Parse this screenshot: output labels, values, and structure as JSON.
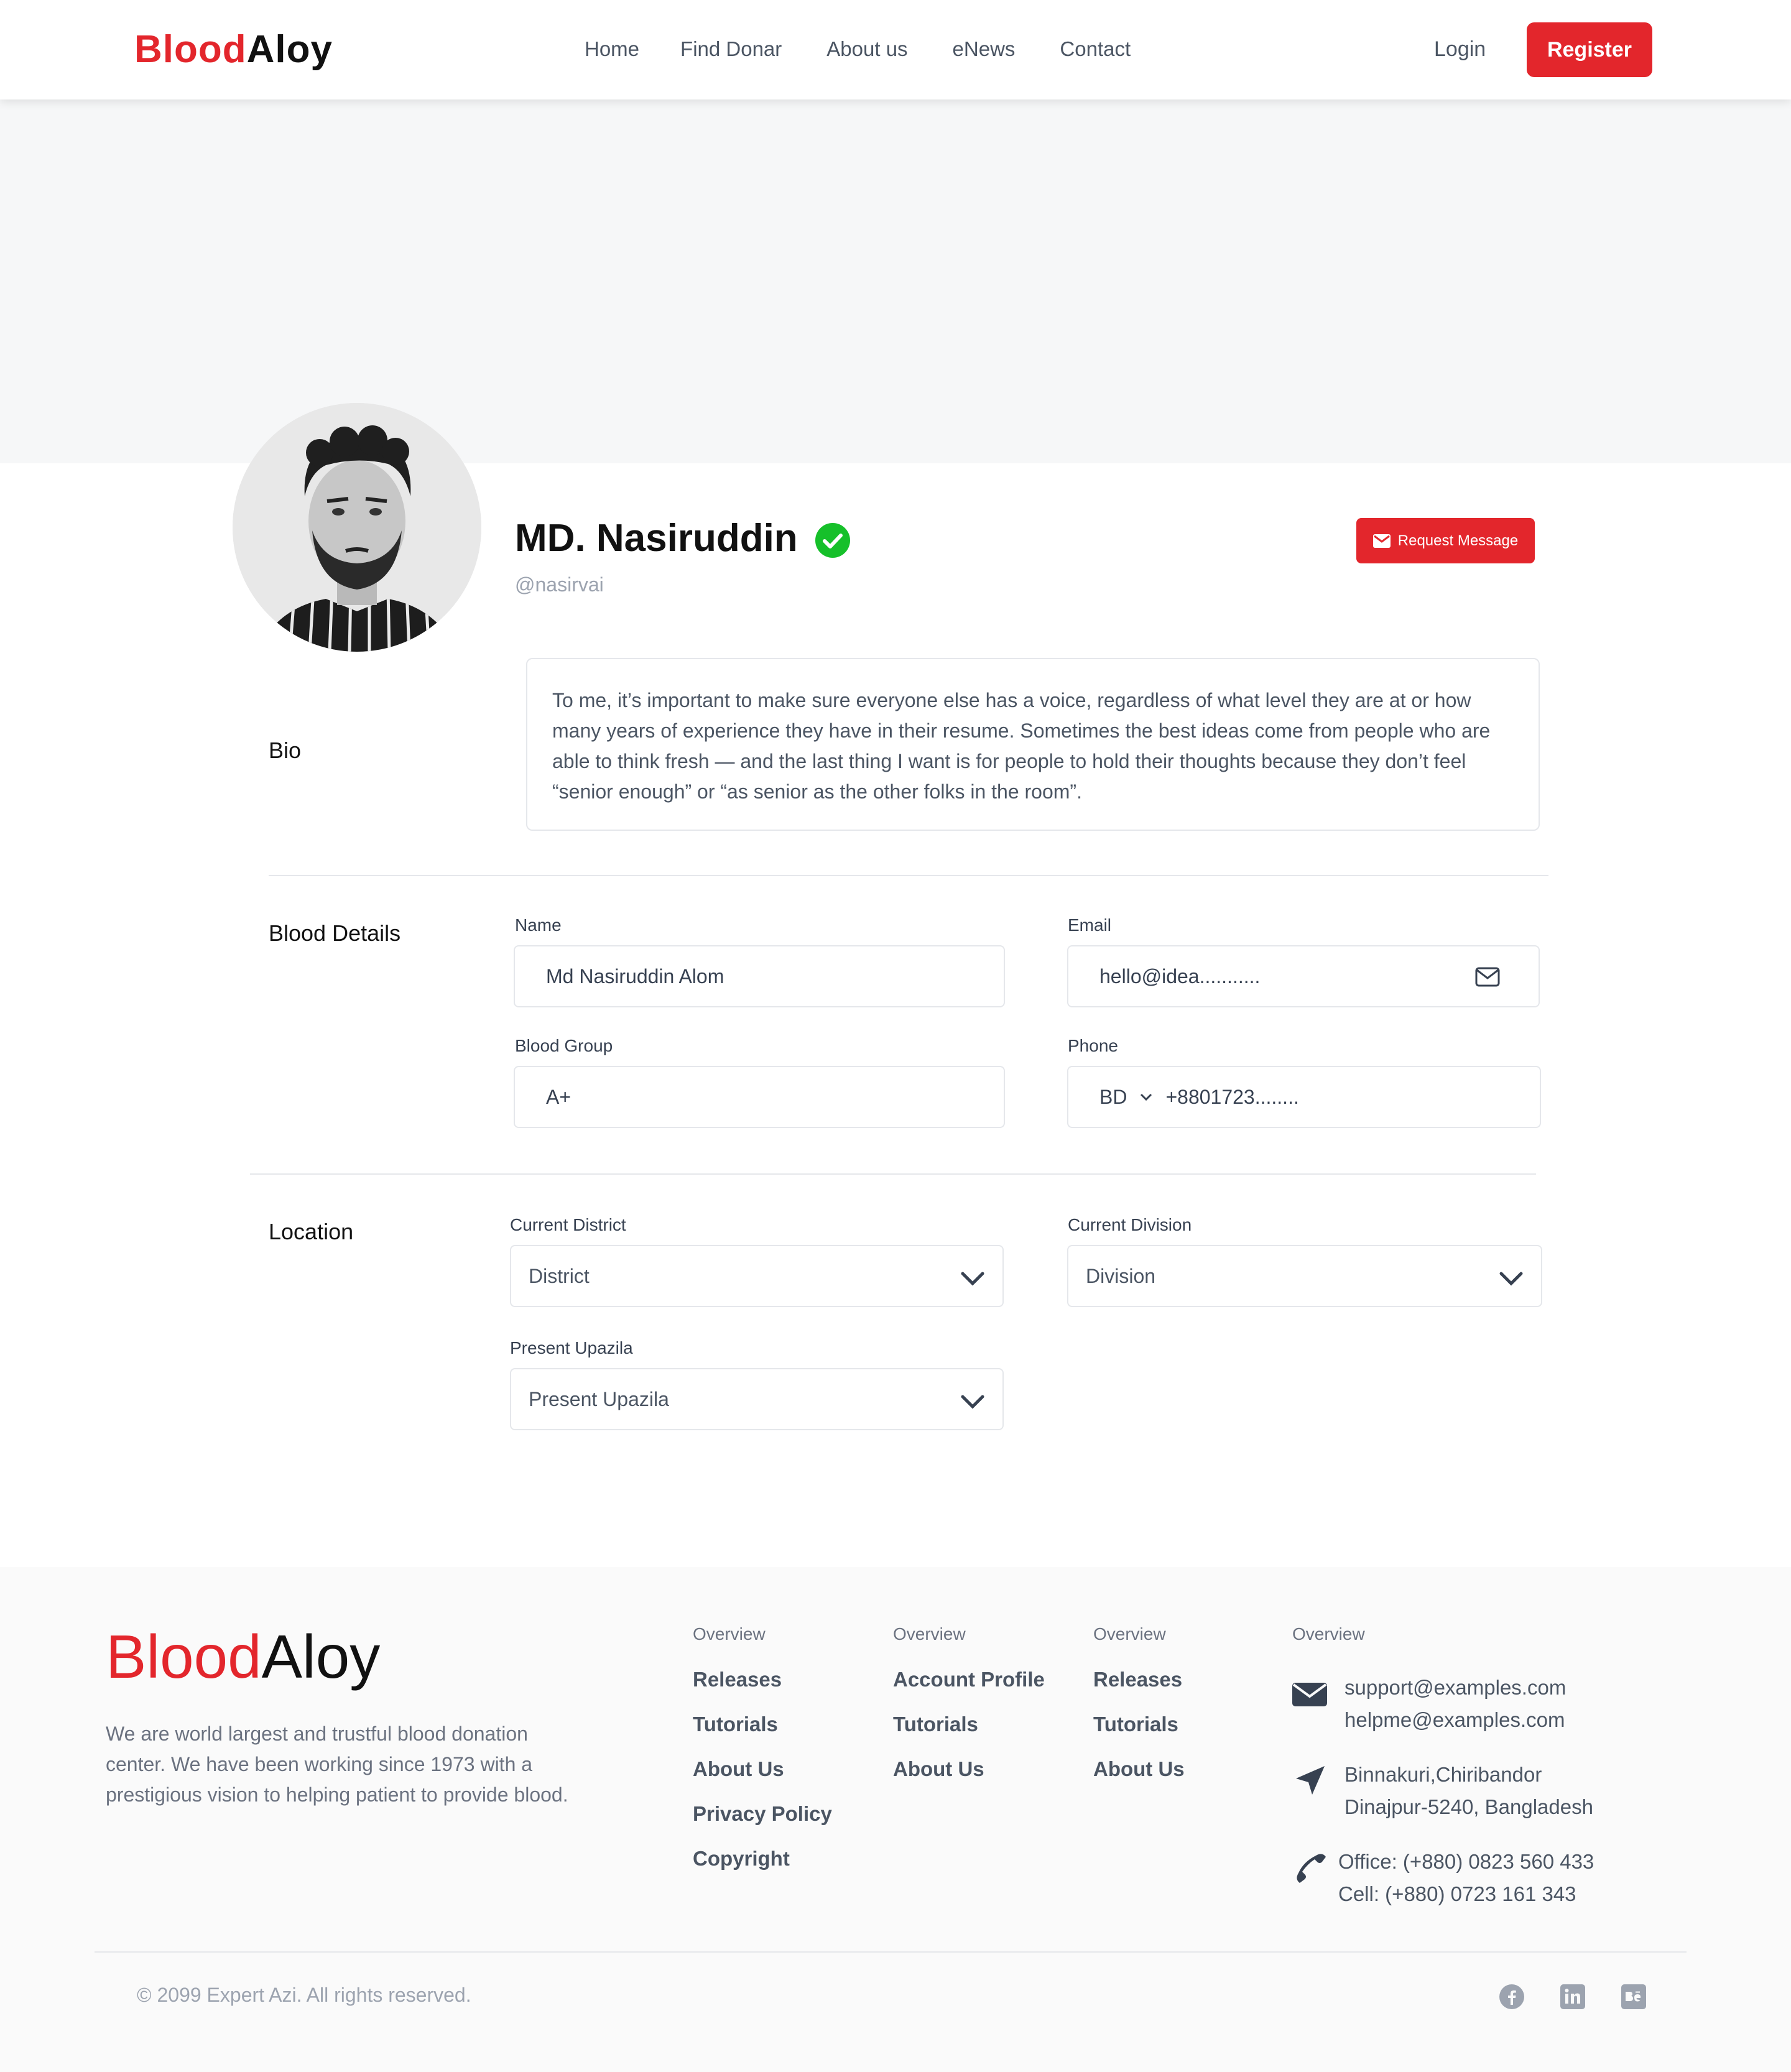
{
  "brand": {
    "part1": "Blood",
    "part2": "Aloy",
    "accent_color": "#e3262c"
  },
  "nav": {
    "items": [
      "Home",
      "Find Donar",
      "About us",
      "eNews",
      "Contact"
    ],
    "login": "Login",
    "register": "Register"
  },
  "profile": {
    "name": "MD. Nasiruddin",
    "handle": "@nasirvai",
    "verified_icon": "check-circle-icon",
    "request_button": "Request Message"
  },
  "bio": {
    "label": "Bio",
    "text": "To me, it’s important to make sure everyone else has a voice, regardless of what level they are at or how many years of experience they have in their resume. Sometimes the best ideas come from people who are able to think fresh — and the last thing I want is for people to hold their thoughts because they don’t feel “senior enough” or “as senior as the other folks in the room”."
  },
  "blood_details": {
    "label": "Blood Details",
    "name_label": "Name",
    "name_value": "Md Nasiruddin Alom",
    "email_label": "Email",
    "email_value": "hello@idea...........",
    "group_label": "Blood Group",
    "group_value": "A+",
    "phone_label": "Phone",
    "phone_country": "BD",
    "phone_value": "+8801723........"
  },
  "location": {
    "label": "Location",
    "district_label": "Current District",
    "district_placeholder": "District",
    "division_label": "Current Division",
    "division_placeholder": "Division",
    "upazila_label": "Present Upazila",
    "upazila_placeholder": "Present Upazila"
  },
  "footer": {
    "description": "We are world largest and trustful blood donation center. We have been working since 1973 with a prestigious vision to helping patient to provide blood.",
    "columns": [
      {
        "head": "Overview",
        "links": [
          "Releases",
          "Tutorials",
          "About Us",
          "Privacy Policy",
          "Copyright"
        ]
      },
      {
        "head": "Overview",
        "links": [
          "Account Profile",
          "Tutorials",
          "About Us"
        ]
      },
      {
        "head": "Overview",
        "links": [
          "Releases",
          "Tutorials",
          "About Us"
        ]
      }
    ],
    "contact_head": "Overview",
    "emails": [
      "support@examples.com",
      "helpme@examples.com"
    ],
    "address": [
      "Binnakuri,Chiribandor",
      "Dinajpur-5240, Bangladesh"
    ],
    "phones": [
      "Office: (+880) 0823 560 433",
      "Cell: (+880) 0723 161 343"
    ],
    "copyright": "© 2099 Expert Azi. All rights reserved.",
    "social_icons": [
      "facebook-icon",
      "linkedin-icon",
      "behance-icon"
    ]
  }
}
